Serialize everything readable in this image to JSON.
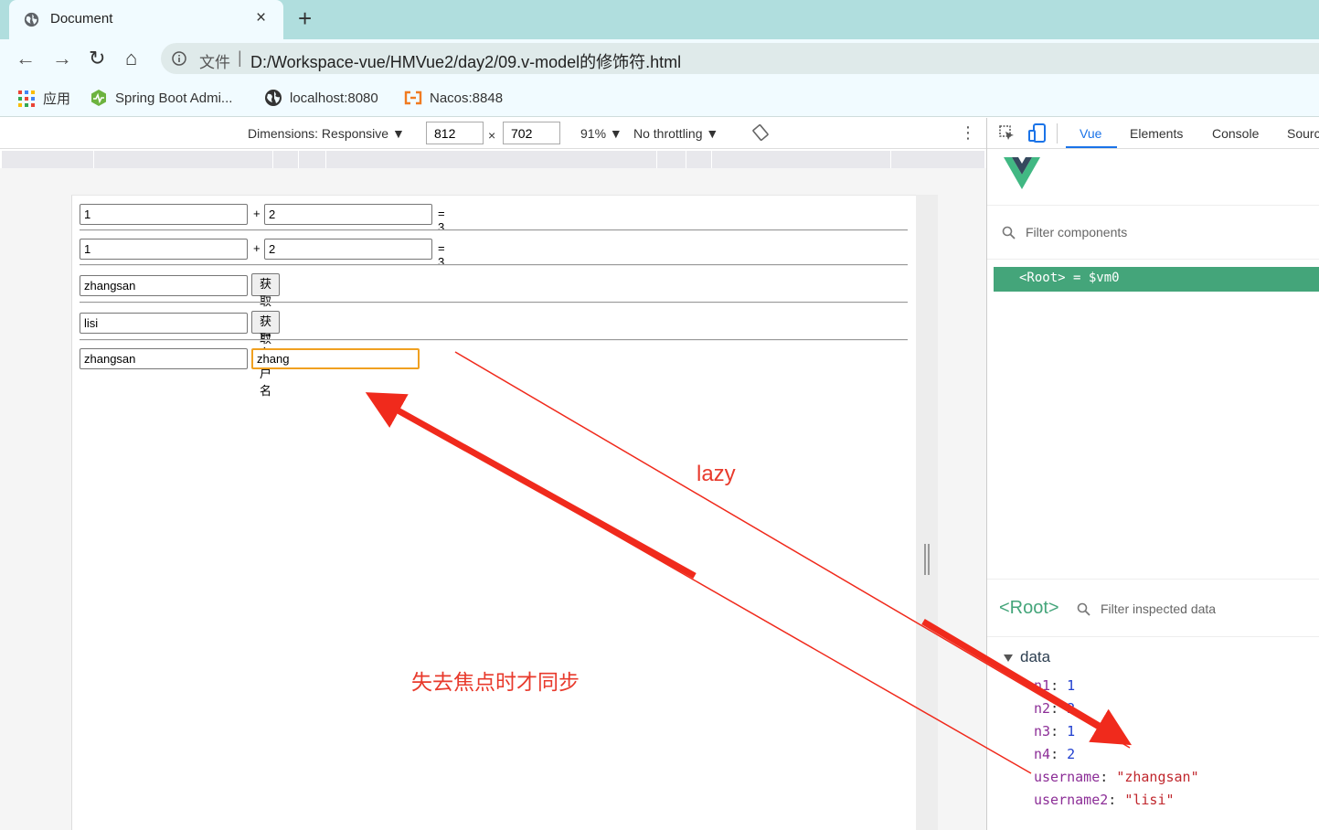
{
  "browser": {
    "tab_title": "Document",
    "tab_close": "×",
    "new_tab": "+",
    "omnibox_label": "文件",
    "omnibox_sep": "|",
    "url": "D:/Workspace-vue/HMVue2/day2/09.v-model的修饰符.html",
    "nav": {
      "back": "←",
      "forward": "→",
      "reload": "↻",
      "home": "⌂"
    },
    "bookmarks": [
      {
        "label": "应用"
      },
      {
        "label": "Spring Boot Admi..."
      },
      {
        "label": "localhost:8080"
      },
      {
        "label": "Nacos:8848"
      }
    ]
  },
  "device_toolbar": {
    "dimensions": "Dimensions: Responsive ▼",
    "width": "812",
    "times": "×",
    "height": "702",
    "zoom": "91% ▼",
    "throttling": "No throttling ▼",
    "more": "⋮"
  },
  "page": {
    "row1": {
      "a": "1",
      "plus": "+",
      "b": "2",
      "result": "= 3"
    },
    "row2": {
      "a": "1",
      "plus": "+",
      "b": "2",
      "result": "= 3"
    },
    "row3": {
      "username": "zhangsan",
      "button": "获取用户名"
    },
    "row4": {
      "username": "lisi",
      "button": "获取用户名"
    },
    "row5": {
      "left": "zhangsan",
      "right": "zhang"
    }
  },
  "devtools": {
    "tabs": [
      "Vue",
      "Elements",
      "Console",
      "Sourc"
    ],
    "filter_components": "Filter components",
    "root_selected": "<Root> = $vm0",
    "inspect_root": "<Root>",
    "filter_inspected": "Filter inspected data",
    "section": "data",
    "props": [
      {
        "key": "n1",
        "value": "1",
        "type": "number"
      },
      {
        "key": "n2",
        "value": "2",
        "type": "number"
      },
      {
        "key": "n3",
        "value": "1",
        "type": "number"
      },
      {
        "key": "n4",
        "value": "2",
        "type": "number"
      },
      {
        "key": "username",
        "value": "\"zhangsan\"",
        "type": "string"
      },
      {
        "key": "username2",
        "value": "\"lisi\"",
        "type": "string"
      }
    ],
    "colors": {
      "vue_green": "#44a57a",
      "active_tab": "#1a73e8"
    }
  },
  "annotations": {
    "lazy": "lazy",
    "note": "失去焦点时才同步",
    "color": "#e83a2c"
  }
}
